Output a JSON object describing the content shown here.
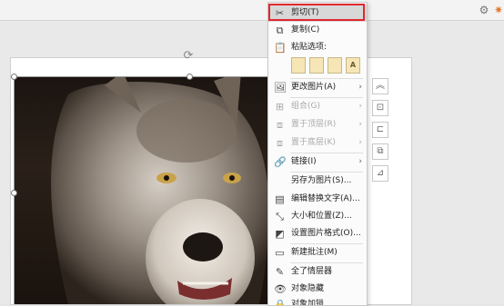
{
  "context_menu": {
    "items": [
      {
        "label": "剪切(T)",
        "icon": "scissors-icon"
      },
      {
        "label": "复制(C)",
        "icon": "copy-icon"
      },
      {
        "label": "粘贴选项:",
        "icon": "paste-icon"
      },
      {
        "label": "更改图片(A)",
        "icon": "change-picture-icon"
      },
      {
        "label": "组合(G)",
        "icon": "group-icon"
      },
      {
        "label": "置于顶层(R)",
        "icon": "bring-to-front-icon"
      },
      {
        "label": "置于底层(K)",
        "icon": "send-to-back-icon"
      },
      {
        "label": "链接(I)",
        "icon": "link-icon"
      },
      {
        "label": "另存为图片(S)...",
        "icon": ""
      },
      {
        "label": "编辑替换文字(A)...",
        "icon": "alt-text-icon"
      },
      {
        "label": "大小和位置(Z)...",
        "icon": "size-position-icon"
      },
      {
        "label": "设置图片格式(O)...",
        "icon": "format-picture-icon"
      },
      {
        "label": "新建批注(M)",
        "icon": "new-comment-icon"
      },
      {
        "label": "全了情层器",
        "icon": "edit-icon"
      },
      {
        "label": "对象隐藏",
        "icon": "eye-icon"
      },
      {
        "label": "对象加锁",
        "icon": "lock-icon"
      }
    ],
    "paste_options": [
      "A"
    ]
  }
}
